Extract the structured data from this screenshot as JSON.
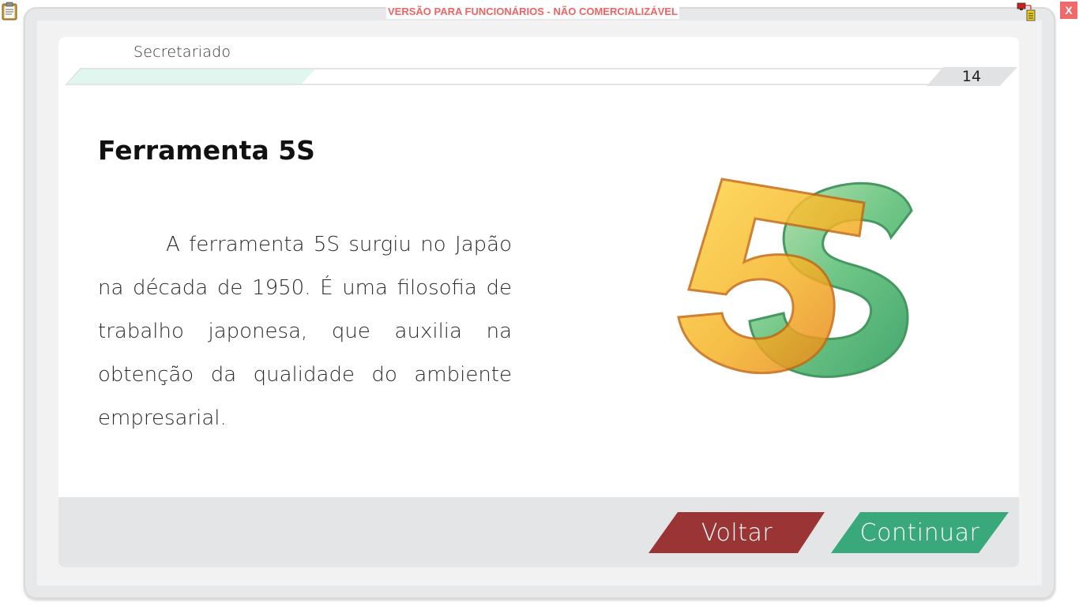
{
  "watermark": "VERSÃO PARA FUNCIONÁRIOS - NÃO COMERCIALIZÁVEL",
  "window_controls": {
    "close_label": "X",
    "clipboard_icon": "clipboard-icon",
    "network_icon": "network-status-icon"
  },
  "header": {
    "module_title": "Secretariado",
    "page_number": "14",
    "progress_fraction": 0.27
  },
  "slide": {
    "heading": "Ferramenta 5S",
    "body": "A ferramenta 5S surgiu no Japão na década de 1950. É uma filosofia de trabalho japonesa, que auxilia na obtenção da qualidade do ambiente empresarial.",
    "illustration": "5s-logo"
  },
  "navigation": {
    "back_label": "Voltar",
    "continue_label": "Continuar"
  },
  "colors": {
    "back_button": "#9b3434",
    "continue_button": "#39a97b",
    "progress_fill": "#dff7ef",
    "watermark": "#ee6363"
  }
}
